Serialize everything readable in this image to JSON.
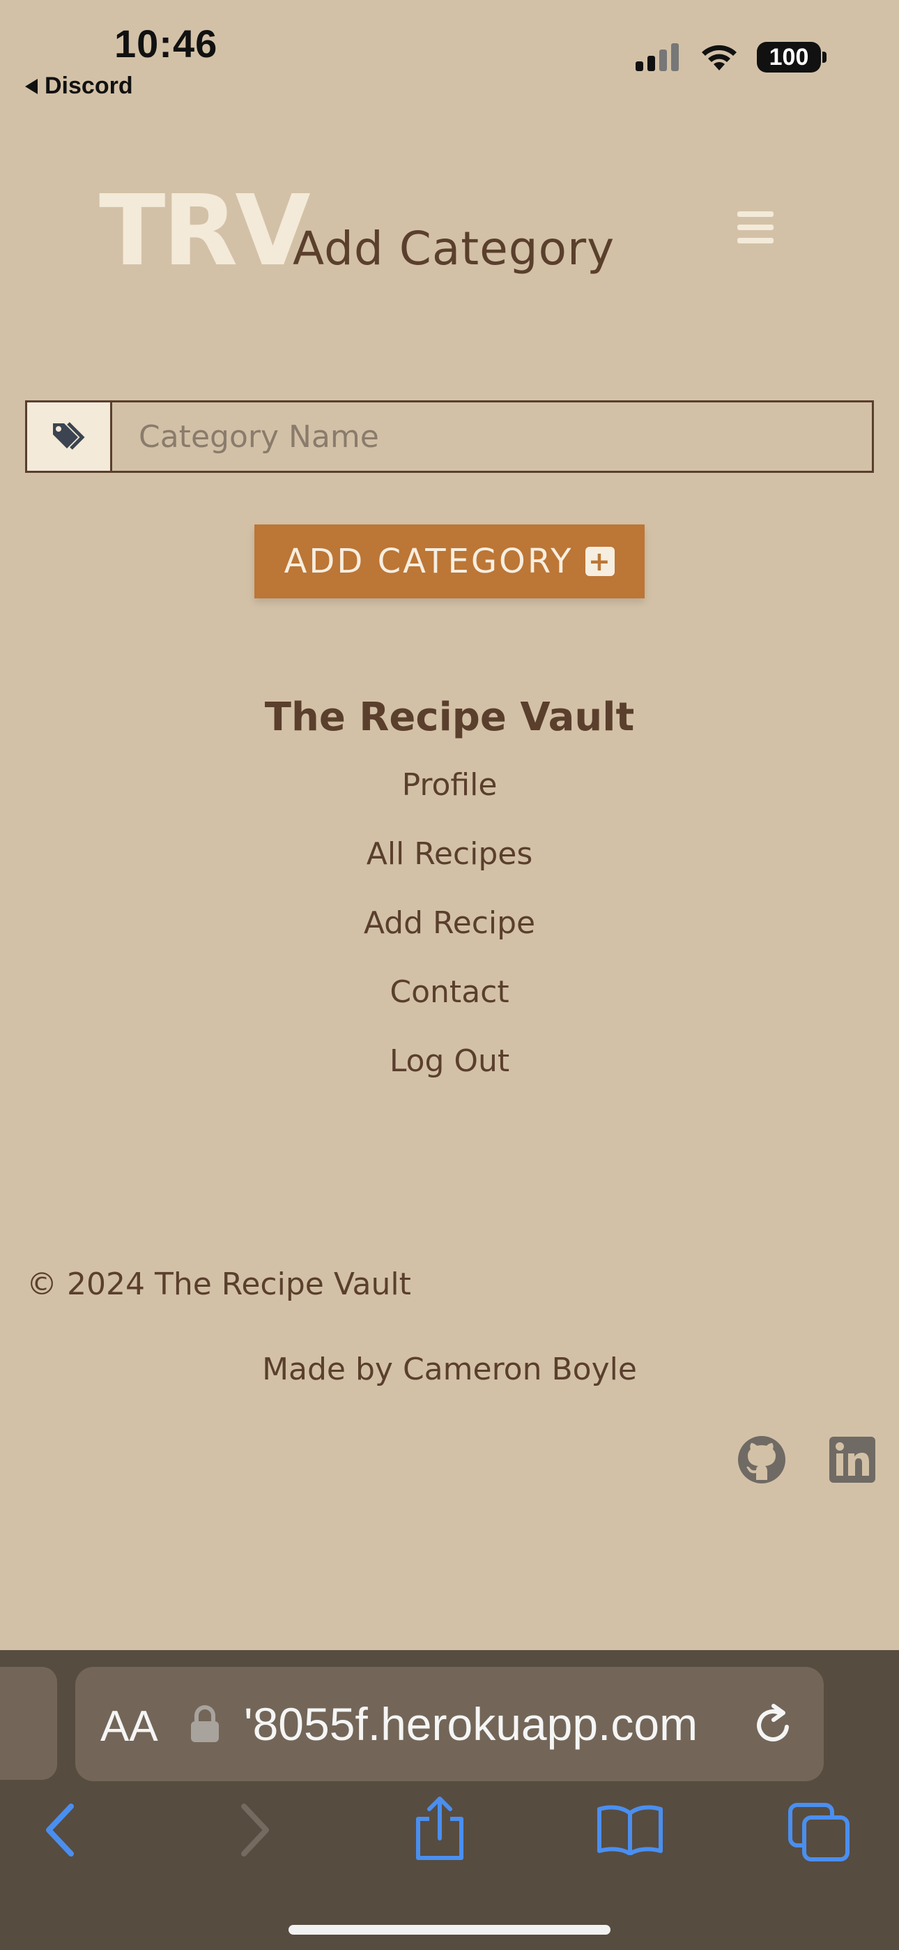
{
  "status_bar": {
    "time": "10:46",
    "back_app": "Discord",
    "battery": "100"
  },
  "header": {
    "logo": "TRV",
    "page_title": "Add Category",
    "menu_icon": "hamburger-menu-icon"
  },
  "form": {
    "icon": "tags-icon",
    "placeholder": "Category Name",
    "value": "",
    "button_label": "ADD CATEGORY",
    "button_icon": "plus-square-icon"
  },
  "footer": {
    "title": "The Recipe Vault",
    "nav": [
      "Profile",
      "All Recipes",
      "Add Recipe",
      "Contact",
      "Log Out"
    ],
    "copyright": "© 2024 The Recipe Vault",
    "made_by": "Made by Cameron Boyle",
    "social_icons": [
      "github-icon",
      "linkedin-icon"
    ]
  },
  "browser": {
    "text_size_label": "AA",
    "url": "'8055f.herokuapp.com",
    "toolbar_icons": [
      "back-icon",
      "forward-icon",
      "share-icon",
      "bookmarks-icon",
      "tabs-icon"
    ]
  },
  "colors": {
    "background": "#d3c1a7",
    "text": "#5a3f2d",
    "accent": "#bc7636",
    "cream": "#f3ead9",
    "browser_chrome": "#574c40",
    "browser_blue": "#4a8ff0"
  }
}
